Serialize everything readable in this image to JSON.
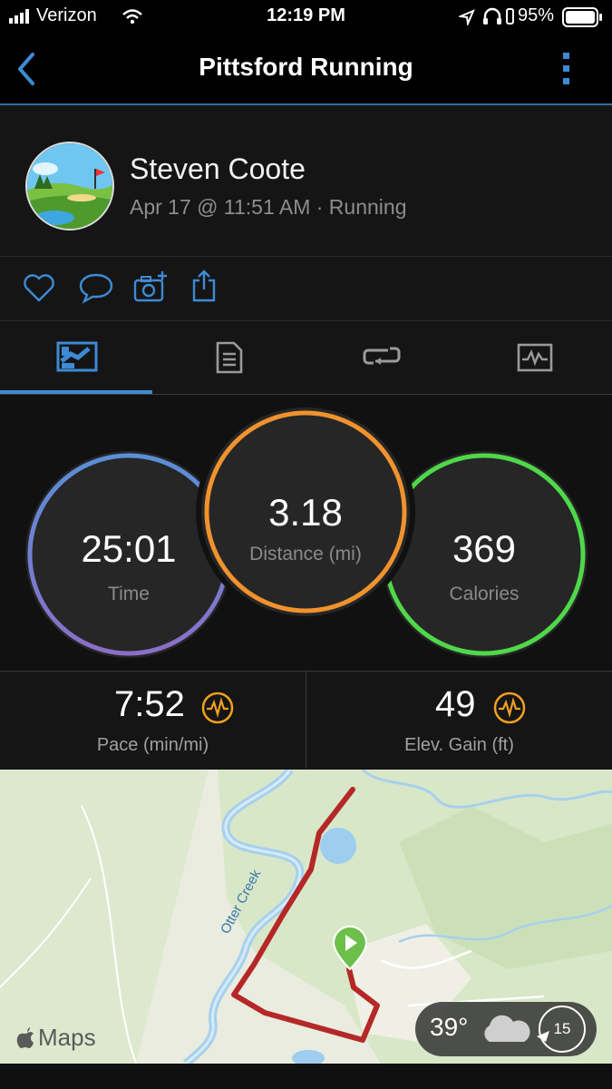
{
  "status_bar": {
    "carrier": "Verizon",
    "time": "12:19 PM",
    "battery": "95%"
  },
  "nav": {
    "title": "Pittsford Running"
  },
  "activity": {
    "user_name": "Steven Coote",
    "meta": "Apr 17 @ 11:51 AM · Running"
  },
  "stats": {
    "time": {
      "value": "25:01",
      "label": "Time"
    },
    "distance": {
      "value": "3.18",
      "label": "Distance (mi)"
    },
    "calories": {
      "value": "369",
      "label": "Calories"
    }
  },
  "metrics": {
    "pace": {
      "value": "7:52",
      "label": "Pace (min/mi)"
    },
    "elevation": {
      "value": "49",
      "label": "Elev. Gain (ft)"
    }
  },
  "map": {
    "brand": "Maps",
    "creek_label": "Otter Creek",
    "temperature": "39°",
    "wind": "15"
  },
  "colors": {
    "accent": "#3d8bd4",
    "time_ring": "#5a8fd8",
    "distance_ring": "#f0922e",
    "calories_ring": "#4fd84a",
    "route": "#b52828",
    "metric_icon": "#f0a020"
  }
}
